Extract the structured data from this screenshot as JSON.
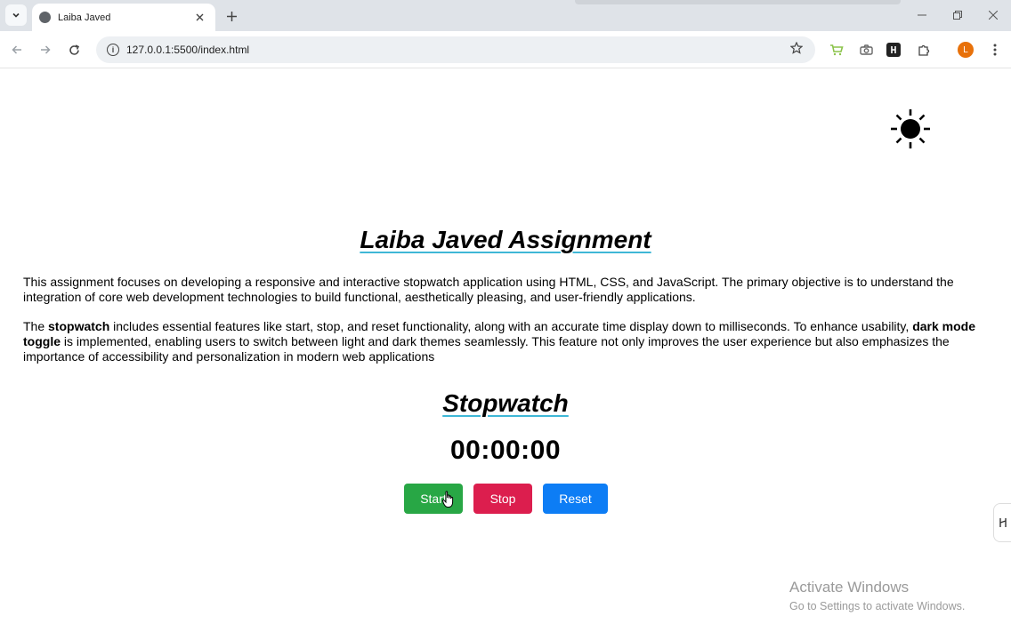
{
  "browser": {
    "tab_title": "Laiba Javed",
    "url": "127.0.0.1:5500/index.html",
    "profile_initial": "L",
    "icons": {
      "tab_menu": "chevron-down-icon",
      "tab_close": "close-icon",
      "new_tab": "plus-icon",
      "back": "arrow-left-icon",
      "forward": "arrow-right-icon",
      "reload": "reload-icon",
      "site_info": "info-icon",
      "bookmark": "star-icon",
      "minimize": "minimize-icon",
      "restore": "restore-icon",
      "close_window": "close-icon"
    }
  },
  "page": {
    "theme_icon": "sun-icon",
    "heading": "Laiba Javed Assignment",
    "paragraph1": "This assignment focuses on developing a responsive and interactive stopwatch application using HTML, CSS, and JavaScript. The primary objective is to understand the integration of core web development technologies to build functional, aesthetically pleasing, and user-friendly applications.",
    "paragraph2": {
      "part1": "The ",
      "bold1": "stopwatch",
      "part2": " includes essential features like start, stop, and reset functionality, along with an accurate time display down to milliseconds. To enhance usability, ",
      "bold2": "dark mode toggle",
      "part3": " is implemented, enabling users to switch between light and dark themes seamlessly. This feature not only improves the user experience but also emphasizes the importance of accessibility and personalization in modern web applications"
    },
    "stopwatch": {
      "title": "Stopwatch",
      "time": "00:00:00",
      "start_label": "Start",
      "stop_label": "Stop",
      "reset_label": "Reset"
    },
    "colors": {
      "start": "#28a745",
      "stop": "#dc1e4e",
      "reset": "#0d7df5",
      "heading_underline": "#3fb7d6"
    }
  },
  "watermark": {
    "line1": "Activate Windows",
    "line2": "Go to Settings to activate Windows."
  }
}
